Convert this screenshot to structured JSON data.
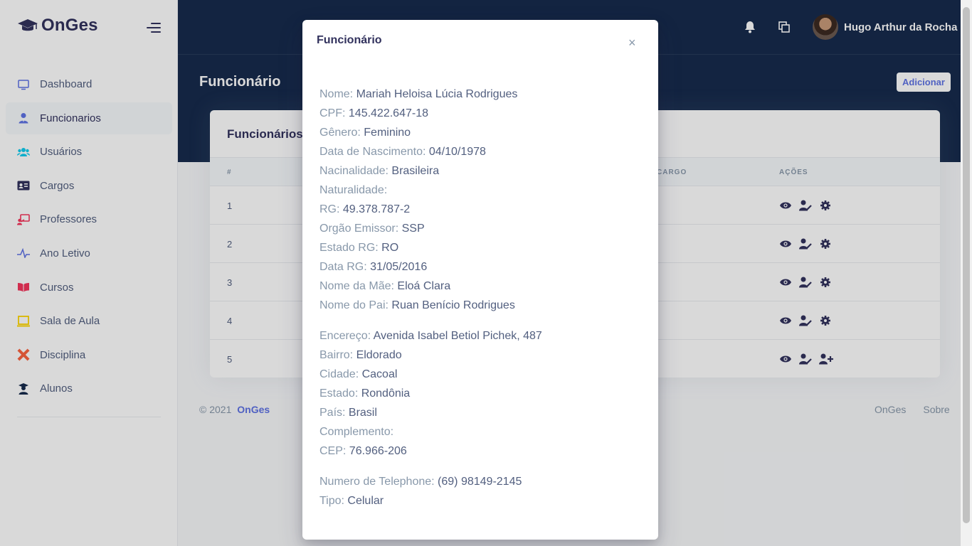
{
  "brand": {
    "name": "OnGes"
  },
  "sidebar": {
    "items": [
      {
        "label": "Dashboard",
        "icon": "monitor-icon",
        "color": "#5e72e4",
        "active": false
      },
      {
        "label": "Funcionarios",
        "icon": "user-tie-icon",
        "color": "#5e72e4",
        "active": true
      },
      {
        "label": "Usuários",
        "icon": "users-icon",
        "color": "#11cdef",
        "active": false
      },
      {
        "label": "Cargos",
        "icon": "id-card-icon",
        "color": "#32325d",
        "active": false
      },
      {
        "label": "Professores",
        "icon": "chalkboard-teacher-icon",
        "color": "#f5365c",
        "active": false
      },
      {
        "label": "Ano Letivo",
        "icon": "activity-icon",
        "color": "#5e72e4",
        "active": false
      },
      {
        "label": "Cursos",
        "icon": "book-icon",
        "color": "#f5365c",
        "active": false
      },
      {
        "label": "Sala de Aula",
        "icon": "laptop-icon",
        "color": "#ffd600",
        "active": false
      },
      {
        "label": "Disciplina",
        "icon": "ruler-pencil-icon",
        "color": "#fb6340",
        "active": false
      },
      {
        "label": "Alunos",
        "icon": "graduate-icon",
        "color": "#172b4d",
        "active": false
      }
    ]
  },
  "header": {
    "user_name": "Hugo Arthur da Rocha",
    "page_title": "Funcionário",
    "add_button": "Adicionar"
  },
  "card": {
    "title": "Funcionários",
    "columns": {
      "id": "#",
      "cargo": "CARGO",
      "acoes": "AÇÕES"
    },
    "rows": [
      {
        "id": "1",
        "actions": [
          "eye-icon",
          "user-edit-icon",
          "gear-icon"
        ]
      },
      {
        "id": "2",
        "actions": [
          "eye-icon",
          "user-edit-icon",
          "gear-icon"
        ]
      },
      {
        "id": "3",
        "actions": [
          "eye-icon",
          "user-edit-icon",
          "gear-icon"
        ]
      },
      {
        "id": "4",
        "actions": [
          "eye-icon",
          "user-edit-icon",
          "gear-icon"
        ]
      },
      {
        "id": "5",
        "actions": [
          "eye-icon",
          "user-edit-icon",
          "user-plus-icon"
        ]
      }
    ]
  },
  "footer": {
    "copyright": "© 2021",
    "brand": "OnGes",
    "links": [
      "OnGes",
      "Sobre"
    ]
  },
  "modal": {
    "title": "Funcionário",
    "close": "×",
    "fields": [
      {
        "k": "Nome: ",
        "v": "Mariah Heloisa Lúcia Rodrigues"
      },
      {
        "k": "CPF: ",
        "v": "145.422.647-18"
      },
      {
        "k": "Gênero: ",
        "v": "Feminino"
      },
      {
        "k": "Data de Nascimento: ",
        "v": "04/10/1978"
      },
      {
        "k": "Nacinalidade: ",
        "v": "Brasileira"
      },
      {
        "k": "Naturalidade: ",
        "v": ""
      },
      {
        "k": "RG: ",
        "v": "49.378.787-2"
      },
      {
        "k": "Orgão Emissor: ",
        "v": "SSP"
      },
      {
        "k": "Estado RG: ",
        "v": "RO"
      },
      {
        "k": "Data RG: ",
        "v": "31/05/2016"
      },
      {
        "k": "Nome da Mãe: ",
        "v": "Eloá Clara"
      },
      {
        "k": "Nome do Pai: ",
        "v": "Ruan Benício Rodrigues"
      },
      {
        "k": "Encereço: ",
        "v": "Avenida Isabel Betiol Pichek, 487"
      },
      {
        "k": "Bairro: ",
        "v": "Eldorado"
      },
      {
        "k": "Cidade: ",
        "v": "Cacoal"
      },
      {
        "k": "Estado: ",
        "v": "Rondônia"
      },
      {
        "k": "País: ",
        "v": "Brasil"
      },
      {
        "k": "Complemento: ",
        "v": ""
      },
      {
        "k": "CEP: ",
        "v": "76.966-206"
      },
      {
        "k": "Numero de Telephone: ",
        "v": "(69) 98149-2145"
      },
      {
        "k": "Tipo: ",
        "v": "Celular"
      }
    ]
  }
}
